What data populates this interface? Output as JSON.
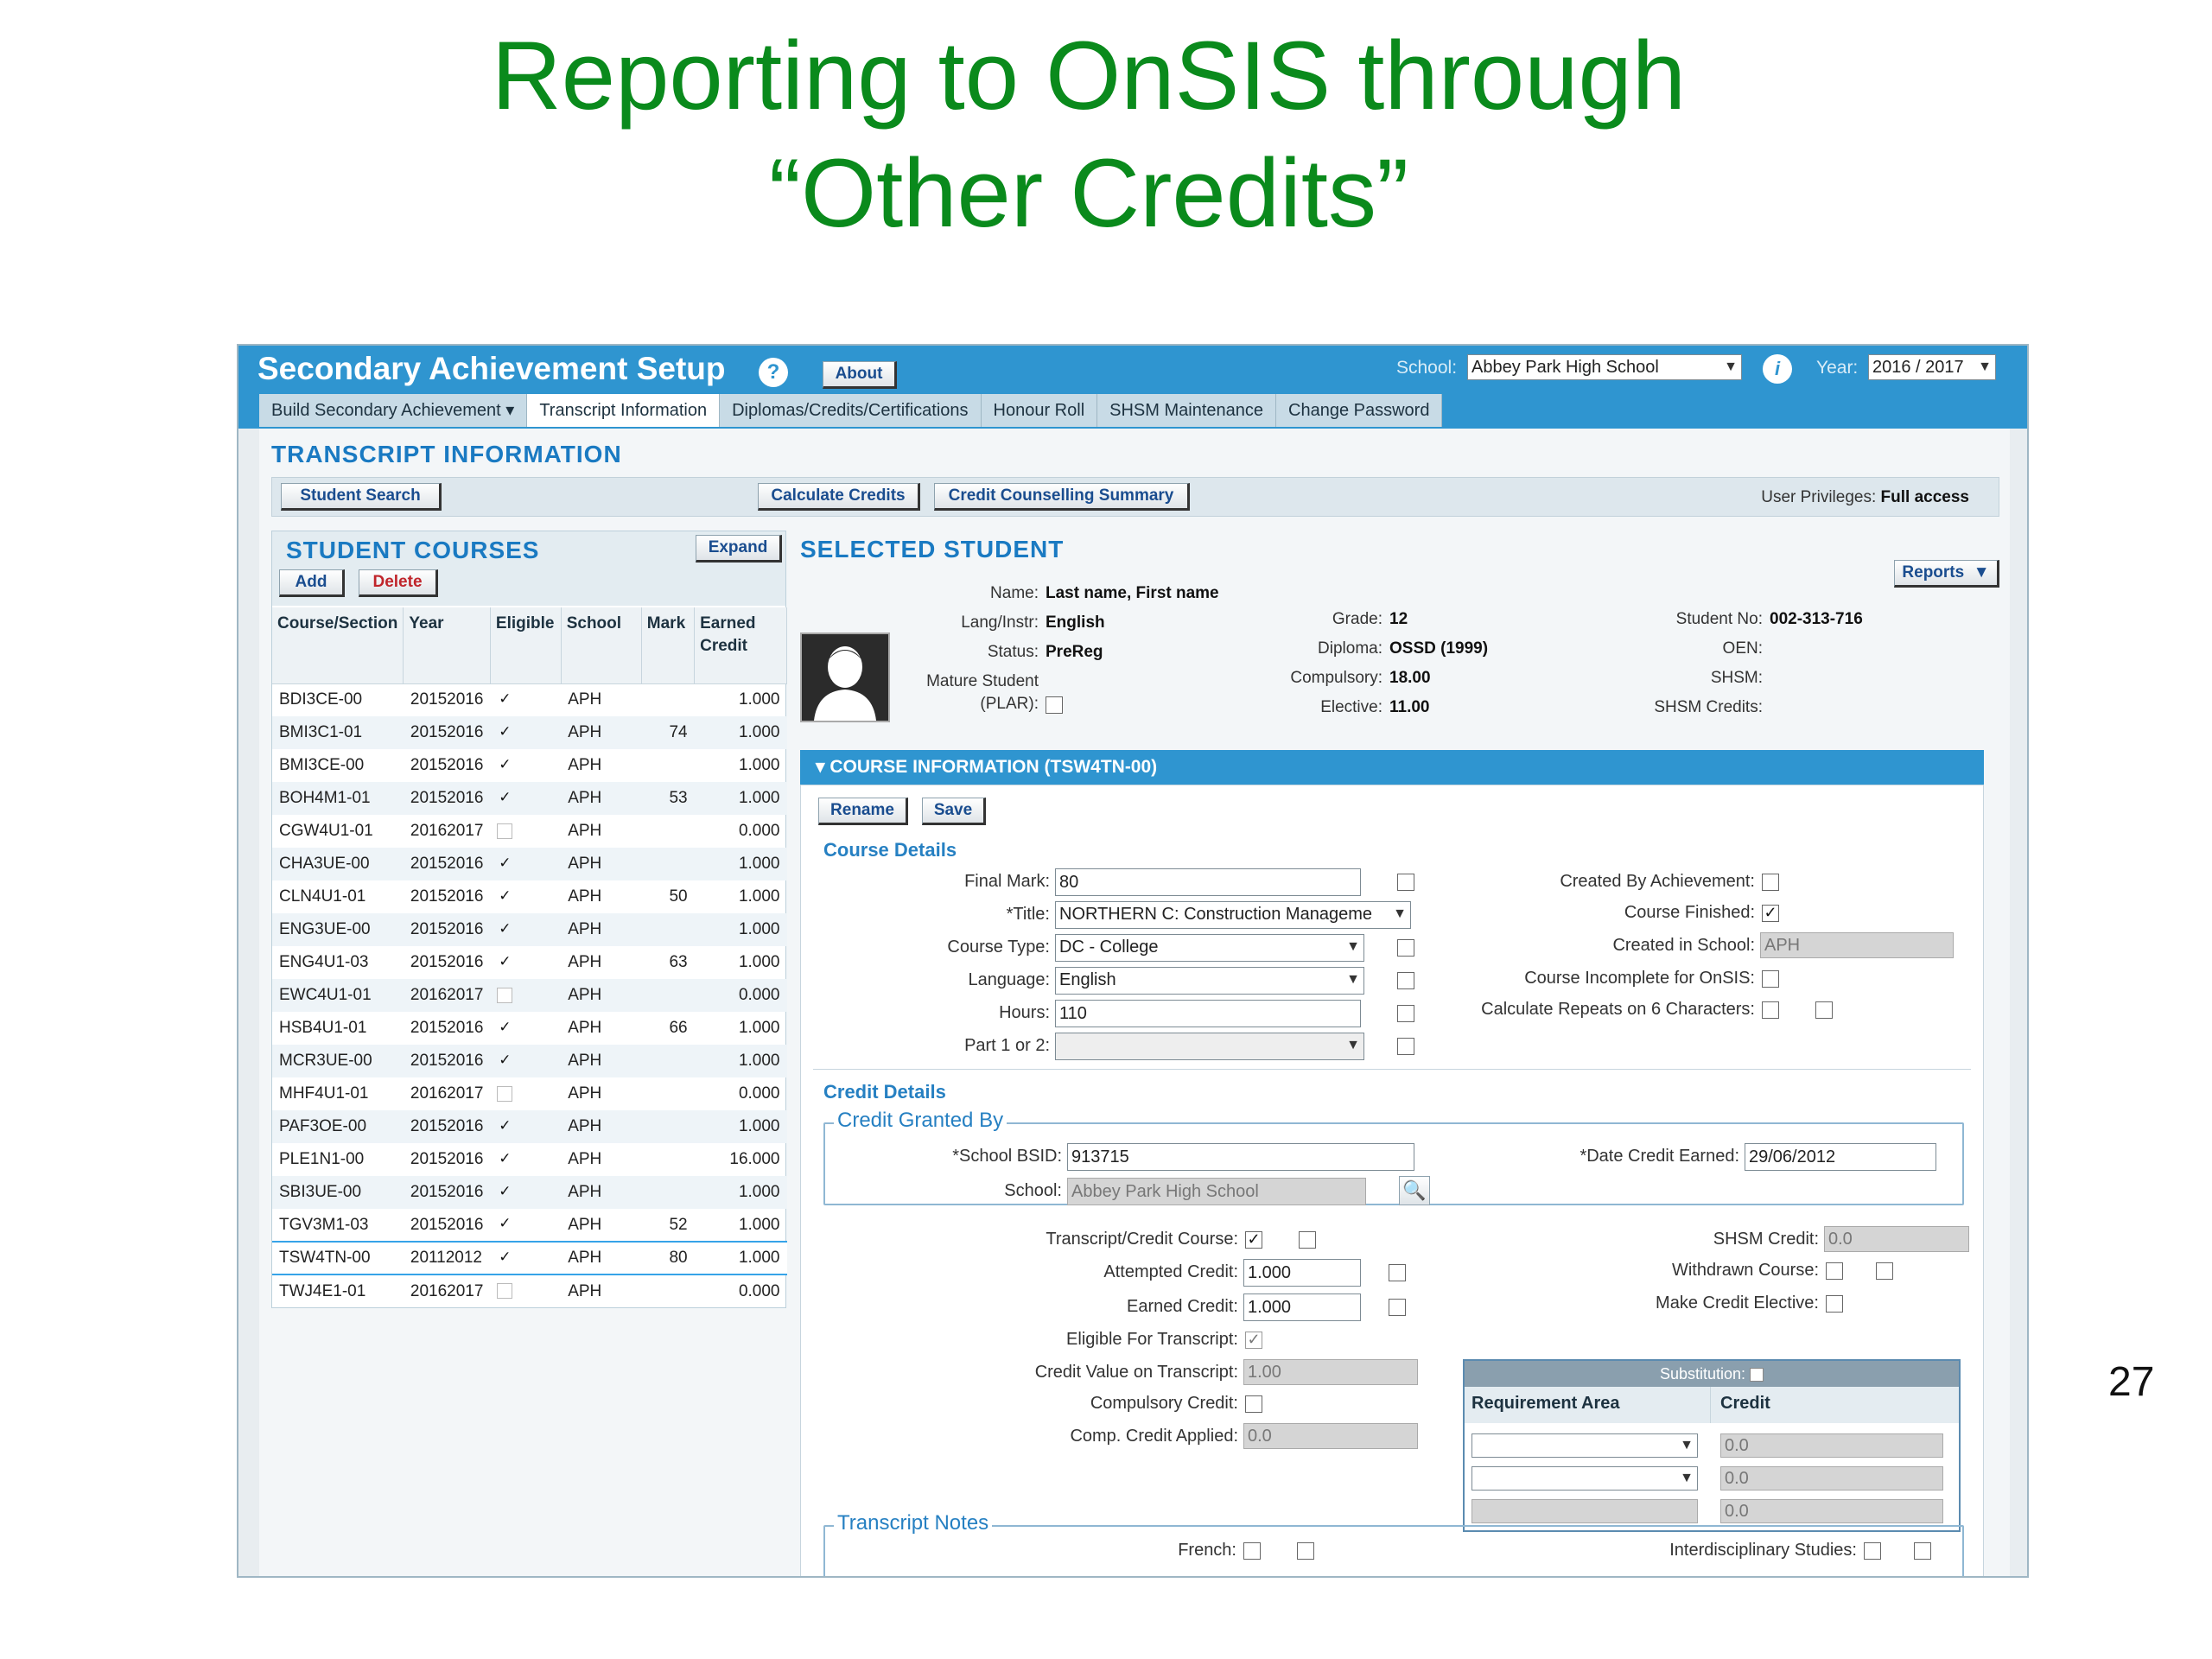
{
  "slide": {
    "title_line1": "Reporting to OnSIS through",
    "title_line2": "“Other Credits”",
    "page_number": "27"
  },
  "app": {
    "title": "Secondary Achievement Setup",
    "help_glyph": "?",
    "about_label": "About",
    "school_label": "School:",
    "school_value": "Abbey Park High School",
    "info_glyph": "i",
    "year_label": "Year:",
    "year_value": "2016 / 2017",
    "tabs": [
      {
        "label": "Build Secondary Achievement"
      },
      {
        "label": "Transcript Information"
      },
      {
        "label": "Diplomas/Credits/Certifications"
      },
      {
        "label": "Honour Roll"
      },
      {
        "label": "SHSM Maintenance"
      },
      {
        "label": "Change Password"
      }
    ]
  },
  "page": {
    "heading": "TRANSCRIPT INFORMATION",
    "student_search_label": "Student Search",
    "calculate_credits_label": "Calculate Credits",
    "credit_counselling_label": "Credit Counselling Summary",
    "privileges_label": "User Privileges:",
    "privileges_value": "Full access"
  },
  "student_courses": {
    "heading": "STUDENT COURSES",
    "expand_label": "Expand",
    "add_label": "Add",
    "delete_label": "Delete",
    "columns": [
      "Course/Section",
      "Year",
      "Eligible",
      "School",
      "Mark",
      "Earned Credit"
    ],
    "rows": [
      {
        "course": "BDI3CE-00",
        "year": "20152016",
        "eligible": true,
        "school": "APH",
        "mark": "",
        "credit": "1.000"
      },
      {
        "course": "BMI3C1-01",
        "year": "20152016",
        "eligible": true,
        "school": "APH",
        "mark": "74",
        "credit": "1.000"
      },
      {
        "course": "BMI3CE-00",
        "year": "20152016",
        "eligible": true,
        "school": "APH",
        "mark": "",
        "credit": "1.000"
      },
      {
        "course": "BOH4M1-01",
        "year": "20152016",
        "eligible": true,
        "school": "APH",
        "mark": "53",
        "credit": "1.000"
      },
      {
        "course": "CGW4U1-01",
        "year": "20162017",
        "eligible": false,
        "school": "APH",
        "mark": "",
        "credit": "0.000"
      },
      {
        "course": "CHA3UE-00",
        "year": "20152016",
        "eligible": true,
        "school": "APH",
        "mark": "",
        "credit": "1.000"
      },
      {
        "course": "CLN4U1-01",
        "year": "20152016",
        "eligible": true,
        "school": "APH",
        "mark": "50",
        "credit": "1.000"
      },
      {
        "course": "ENG3UE-00",
        "year": "20152016",
        "eligible": true,
        "school": "APH",
        "mark": "",
        "credit": "1.000"
      },
      {
        "course": "ENG4U1-03",
        "year": "20152016",
        "eligible": true,
        "school": "APH",
        "mark": "63",
        "credit": "1.000"
      },
      {
        "course": "EWC4U1-01",
        "year": "20162017",
        "eligible": false,
        "school": "APH",
        "mark": "",
        "credit": "0.000"
      },
      {
        "course": "HSB4U1-01",
        "year": "20152016",
        "eligible": true,
        "school": "APH",
        "mark": "66",
        "credit": "1.000"
      },
      {
        "course": "MCR3UE-00",
        "year": "20152016",
        "eligible": true,
        "school": "APH",
        "mark": "",
        "credit": "1.000"
      },
      {
        "course": "MHF4U1-01",
        "year": "20162017",
        "eligible": false,
        "school": "APH",
        "mark": "",
        "credit": "0.000"
      },
      {
        "course": "PAF3OE-00",
        "year": "20152016",
        "eligible": true,
        "school": "APH",
        "mark": "",
        "credit": "1.000"
      },
      {
        "course": "PLE1N1-00",
        "year": "20152016",
        "eligible": true,
        "school": "APH",
        "mark": "",
        "credit": "16.000"
      },
      {
        "course": "SBI3UE-00",
        "year": "20152016",
        "eligible": true,
        "school": "APH",
        "mark": "",
        "credit": "1.000"
      },
      {
        "course": "TGV3M1-03",
        "year": "20152016",
        "eligible": true,
        "school": "APH",
        "mark": "52",
        "credit": "1.000"
      },
      {
        "course": "TSW4TN-00",
        "year": "20112012",
        "eligible": true,
        "school": "APH",
        "mark": "80",
        "credit": "1.000",
        "selected": true
      },
      {
        "course": "TWJ4E1-01",
        "year": "20162017",
        "eligible": false,
        "school": "APH",
        "mark": "",
        "credit": "0.000"
      }
    ]
  },
  "selected_student": {
    "heading": "SELECTED STUDENT",
    "reports_label": "Reports",
    "name_label": "Name:",
    "name_value": "Last name, First name",
    "lang_label": "Lang/Instr:",
    "lang_value": "English",
    "status_label": "Status:",
    "status_value": "PreReg",
    "mature_label": "Mature Student",
    "plar_label": "(PLAR):",
    "grade_label": "Grade:",
    "grade_value": "12",
    "diploma_label": "Diploma:",
    "diploma_value": "OSSD (1999)",
    "compulsory_label": "Compulsory:",
    "compulsory_value": "18.00",
    "elective_label": "Elective:",
    "elective_value": "11.00",
    "studentno_label": "Student No:",
    "studentno_value": "002-313-716",
    "oen_label": "OEN:",
    "shsm_label": "SHSM:",
    "shsm_credits_label": "SHSM Credits:"
  },
  "course_info": {
    "header": "COURSE INFORMATION (TSW4TN-00)",
    "rename_label": "Rename",
    "save_label": "Save",
    "course_details_heading": "Course Details",
    "final_mark_label": "Final Mark:",
    "final_mark_value": "80",
    "title_label": "*Title:",
    "title_value": "NORTHERN C: Construction Manageme",
    "course_type_label": "Course Type:",
    "course_type_value": "DC - College",
    "language_label": "Language:",
    "language_value": "English",
    "hours_label": "Hours:",
    "hours_value": "110",
    "part_label": "Part 1 or 2:",
    "created_by_ach_label": "Created By Achievement:",
    "course_finished_label": "Course Finished:",
    "created_in_school_label": "Created in School:",
    "created_in_school_value": "APH",
    "incomplete_label": "Course Incomplete for OnSIS:",
    "repeats_label": "Calculate Repeats on 6 Characters:",
    "credit_details_heading": "Credit Details",
    "granted_by_legend": "Credit Granted By",
    "bsid_label": "*School BSID:",
    "bsid_value": "913715",
    "date_earned_label": "*Date Credit Earned:",
    "date_earned_value": "29/06/2012",
    "school_label": "School:",
    "school_value": "Abbey Park High School",
    "transcript_credit_label": "Transcript/Credit Course:",
    "attempted_label": "Attempted Credit:",
    "attempted_value": "1.000",
    "earned_label": "Earned Credit:",
    "earned_value": "1.000",
    "eligible_label": "Eligible For Transcript:",
    "credit_value_label": "Credit Value on Transcript:",
    "credit_value_value": "1.00",
    "compulsory_credit_label": "Compulsory Credit:",
    "comp_applied_label": "Comp. Credit Applied:",
    "comp_applied_value": "0.0",
    "shsm_credit_label": "SHSM Credit:",
    "shsm_credit_value": "0.0",
    "withdrawn_label": "Withdrawn Course:",
    "make_elective_label": "Make Credit Elective:",
    "substitution_label": "Substitution:",
    "req_area_col": "Requirement Area",
    "credit_col": "Credit",
    "sub_rows": [
      {
        "credit": "0.0"
      },
      {
        "credit": "0.0"
      },
      {
        "credit": "0.0"
      }
    ],
    "transcript_notes_legend": "Transcript Notes",
    "french_label": "French:",
    "interdisciplinary_label": "Interdisciplinary Studies:"
  }
}
